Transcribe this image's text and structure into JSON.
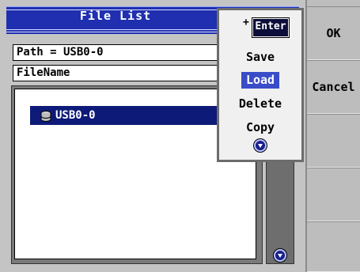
{
  "dialog": {
    "title": "File List",
    "path": "Path = USB0-0",
    "filename_header": "FileName"
  },
  "file_list": {
    "items": [
      {
        "label": "USB0-0",
        "icon": "drive-icon",
        "selected": true
      }
    ]
  },
  "menu": {
    "enter_prefix": "+",
    "enter_label": "Enter",
    "items": [
      {
        "label": "Save"
      },
      {
        "label": "Load",
        "selected": true
      },
      {
        "label": "Delete"
      },
      {
        "label": "Copy"
      }
    ]
  },
  "softkeys": [
    {
      "label": "OK"
    },
    {
      "label": "Cancel"
    },
    {
      "label": ""
    },
    {
      "label": ""
    },
    {
      "label": ""
    }
  ],
  "colors": {
    "title_bar": "#1f2fb0",
    "selection": "#0e1a78",
    "menu_selection": "#3a4cc8"
  }
}
